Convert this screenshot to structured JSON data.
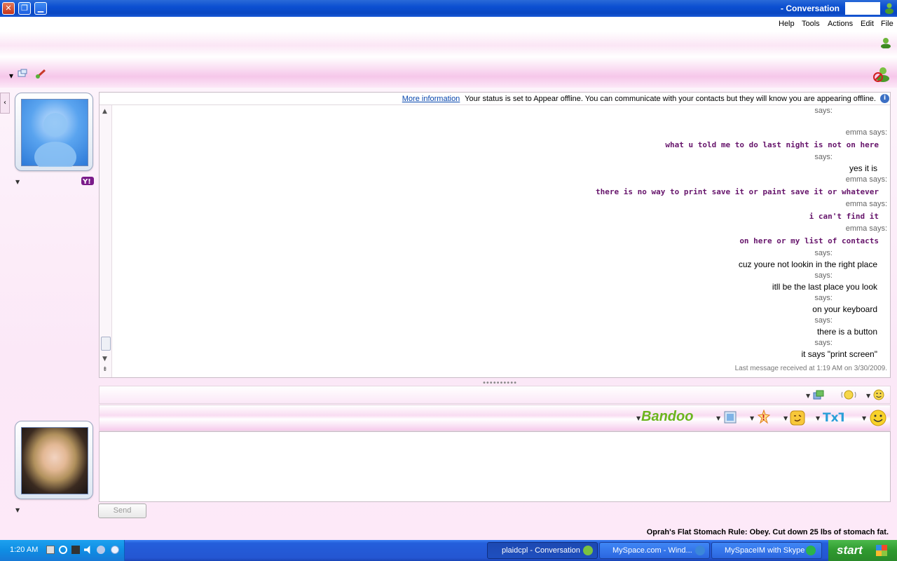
{
  "window": {
    "title": "- Conversation",
    "controls": {
      "close": "✕",
      "restore": "❐",
      "minimize": "▁"
    }
  },
  "menu": {
    "items": [
      "File",
      "Edit",
      "Actions",
      "Tools",
      "Help"
    ]
  },
  "status_bar": {
    "text": "Your status is set to Appear offline. You can communicate with your contacts but they will know you are appearing offline.",
    "link": "More information"
  },
  "conversation": {
    "messages": [
      {
        "speaker": "says:",
        "text": ""
      },
      {
        "speaker": "emma says:",
        "text": "what u told me to do last night is not on here"
      },
      {
        "speaker": "says:",
        "text": "yes it is"
      },
      {
        "speaker": "emma says:",
        "text": "there is no way to print save it or paint save it or whatever"
      },
      {
        "speaker": "emma says:",
        "text": "i can't find it"
      },
      {
        "speaker": "emma says:",
        "text": "on here or my list of contacts"
      },
      {
        "speaker": "says:",
        "text": "cuz youre not lookin in the right place"
      },
      {
        "speaker": "says:",
        "text": "itll be the last place you look"
      },
      {
        "speaker": "says:",
        "text": "on your keyboard"
      },
      {
        "speaker": "says:",
        "text": "there is a button"
      },
      {
        "speaker": "says:",
        "text": "it says \"print screen\""
      }
    ],
    "last_received": "Last message received at 1:19 AM on 3/30/2009."
  },
  "compose": {
    "send_label": "Send",
    "ad_text": "Oprah's Flat Stomach Rule: Obey. Cut down 25 lbs of stomach fat.",
    "brand": "Bandoo"
  },
  "taskbar": {
    "start_label": "start",
    "buttons": [
      {
        "label": "MySpaceIM with Skype"
      },
      {
        "label": "MySpace.com - Wind..."
      },
      {
        "label": "plaidcpl - Conversation"
      }
    ],
    "clock": "1:20 AM"
  },
  "colors": {
    "titlebar": "#0b4fd1",
    "emma_text": "#66146b",
    "pink_band": "#f6c7ea",
    "taskbar": "#245edb",
    "start": "#2f9a2f"
  }
}
